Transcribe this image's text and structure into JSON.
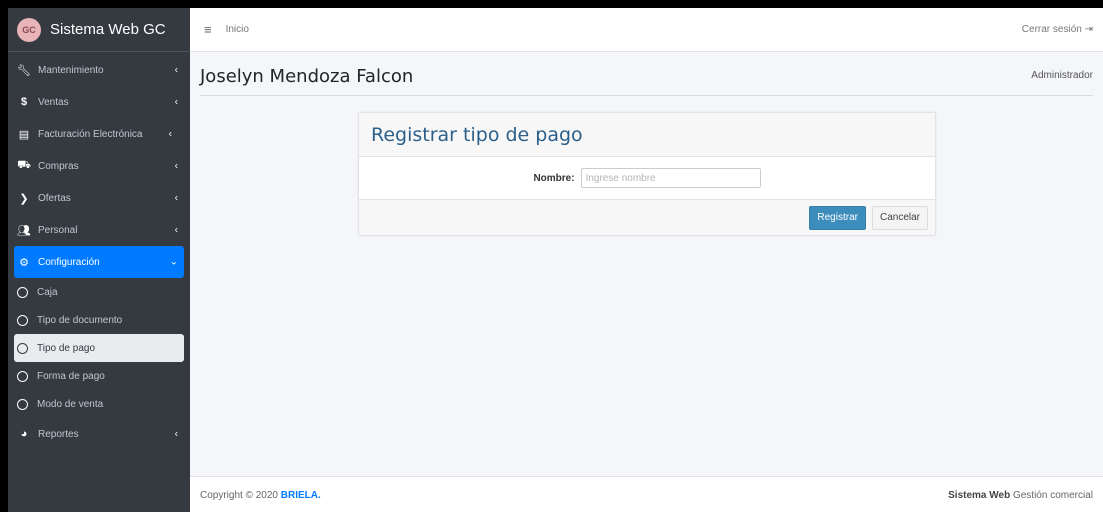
{
  "app": {
    "title": "Sistema Web GC",
    "logo_text": "GC"
  },
  "topbar": {
    "menu_glyph": "≡",
    "breadcrumb": "Inicio",
    "logout": "Cerrar sesión"
  },
  "sidebar": {
    "items": [
      {
        "label": "Mantenimiento",
        "icon": "wrench-icon"
      },
      {
        "label": "Ventas",
        "icon": "dollar-icon"
      },
      {
        "label": "Facturación Electrónica",
        "icon": "file-icon"
      },
      {
        "label": "Compras",
        "icon": "cart-icon"
      },
      {
        "label": "Ofertas",
        "icon": "tags-icon"
      },
      {
        "label": "Personal",
        "icon": "users-icon"
      },
      {
        "label": "Configuración",
        "icon": "gear-icon"
      }
    ],
    "subitems": [
      {
        "label": "Caja"
      },
      {
        "label": "Tipo de documento"
      },
      {
        "label": "Tipo de pago"
      },
      {
        "label": "Forma de pago"
      },
      {
        "label": "Modo de venta"
      }
    ],
    "reportes": {
      "label": "Reportes",
      "icon": "pie-chart-icon"
    }
  },
  "header": {
    "user_name": "Joselyn Mendoza Falcon",
    "role": "Administrador"
  },
  "form": {
    "title": "Registrar tipo de pago",
    "name_label": "Nombre:",
    "name_value": "",
    "name_placeholder": "Ingrese nombre",
    "submit_label": "Registrar",
    "cancel_label": "Cancelar"
  },
  "footer": {
    "copyright": "Copyright © 2020",
    "company": "BRIELA.",
    "right_bold": "Sistema Web",
    "right_text": "Gestión comercial"
  },
  "colors": {
    "sidebar_bg": "#343a40",
    "accent": "#007bff",
    "primary_button": "#3c8dbc",
    "title_blue": "#2c5f8a"
  }
}
